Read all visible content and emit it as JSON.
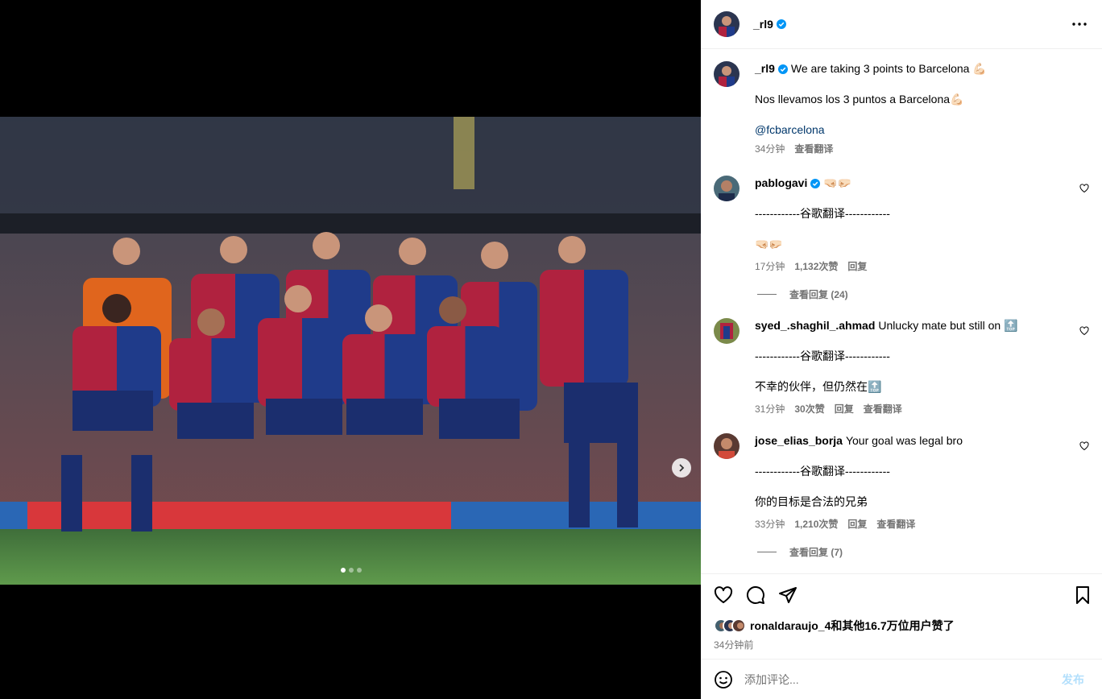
{
  "post": {
    "username": "_rl9",
    "caption_line1": "We are taking 3 points to Barcelona 💪🏻",
    "caption_line2": "Nos llevamos los 3 puntos a Barcelona💪🏻",
    "mention": "@fcbarcelona",
    "time": "34分钟",
    "translate": "查看翻译",
    "carousel": {
      "count": 3,
      "active": 1
    }
  },
  "comments": [
    {
      "username": "pablogavi",
      "text": "🤜🏻🤛🏻",
      "divider": "------------谷歌翻译------------",
      "translated": "🤜🏻🤛🏻",
      "time": "17分钟",
      "likes": "1,132次赞",
      "reply": "回复",
      "view_replies": "查看回复 (24)"
    },
    {
      "username": "syed_.shaghil_.ahmad",
      "text": "Unlucky mate but still on 🔝",
      "divider": "------------谷歌翻译------------",
      "translated": "不幸的伙伴，但仍然在🔝",
      "time": "31分钟",
      "likes": "30次赞",
      "reply": "回复",
      "translate": "查看翻译"
    },
    {
      "username": "jose_elias_borja",
      "text": "Your goal was legal bro",
      "divider": "------------谷歌翻译------------",
      "translated": "你的目标是合法的兄弟",
      "time": "33分钟",
      "likes": "1,210次赞",
      "reply": "回复",
      "translate": "查看翻译",
      "view_replies": "查看回复 (7)"
    }
  ],
  "likes_summary": "ronaldaraujo_4和其他16.7万位用户赞了",
  "posted_ago": "34分钟前",
  "compose": {
    "placeholder": "添加评论...",
    "post_label": "发布"
  },
  "colors": {
    "verified": "#0095f6",
    "mention": "#00376b",
    "muted": "#737373",
    "post_disabled": "#b2dffc"
  },
  "icons": [
    "more-icon",
    "heart-icon",
    "comment-icon",
    "share-icon",
    "bookmark-icon",
    "emoji-icon",
    "chevron-right-icon",
    "verified-badge-icon"
  ]
}
